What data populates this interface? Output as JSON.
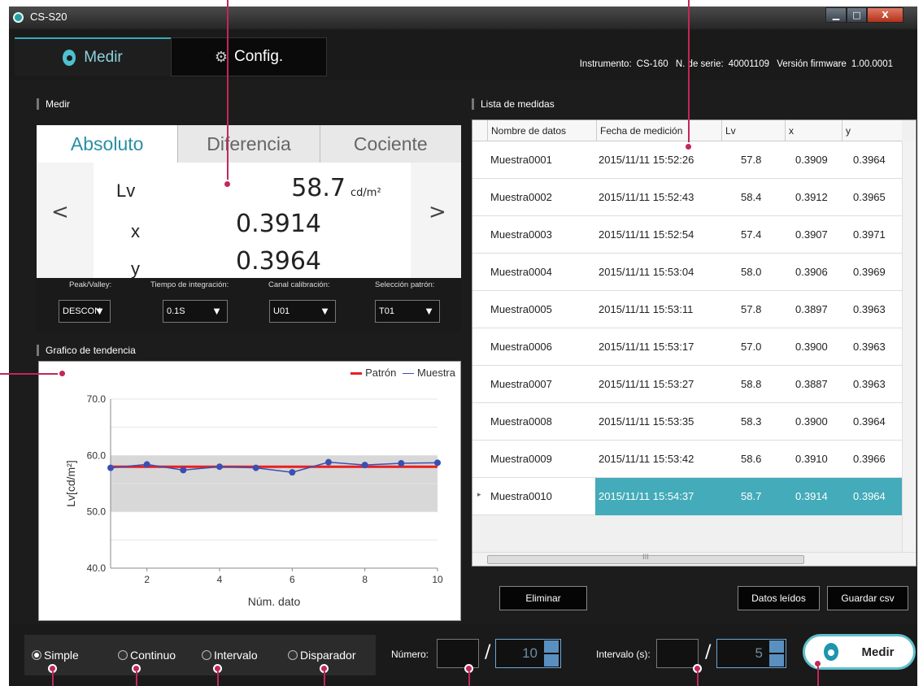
{
  "window": {
    "title": "CS-S20",
    "min": "▁",
    "max": "□",
    "close": "X"
  },
  "tabs": {
    "medir": "Medir",
    "config": "Config."
  },
  "instrument": {
    "instr_label": "Instrumento:",
    "instr_value": "CS-160",
    "serial_label": "N. de serie:",
    "serial_value": "40001109",
    "fw_label": "Versión firmware",
    "fw_value": "1.00.0001"
  },
  "sections": {
    "medir": "Medir",
    "lista": "Lista de medidas",
    "grafico": "Grafico de tendencia"
  },
  "measure": {
    "tabs": [
      "Absoluto",
      "Diferencia",
      "Cociente"
    ],
    "lv_label": "Lv",
    "lv_value": "58.7",
    "lv_unit": "cd/m²",
    "x_label": "x",
    "x_value": "0.3914",
    "y_label": "y",
    "y_value": "0.3964",
    "prev": "<",
    "next": ">"
  },
  "settings": {
    "peak_label": "Peak/Valley:",
    "peak_value": "DESCON",
    "tiempo_label": "Tiempo de integración:",
    "tiempo_value": "0.1S",
    "canal_label": "Canal calibración:",
    "canal_value": "U01",
    "patron_label": "Selección patrón:",
    "patron_value": "T01"
  },
  "chart_data": {
    "type": "line",
    "xlabel": "Núm. dato",
    "ylabel": "Lv[cd/m²]",
    "ylim": [
      40,
      70
    ],
    "xlim": [
      1,
      10
    ],
    "yticks": [
      "70.0",
      "60.0",
      "50.0",
      "40.0"
    ],
    "xticks": [
      "2",
      "4",
      "6",
      "8",
      "10"
    ],
    "band": [
      50,
      60
    ],
    "legend_patron": "Patrón",
    "legend_muestra": "Muestra",
    "series": [
      {
        "name": "Patrón",
        "values": [
          58.0,
          58.0,
          58.0,
          58.0,
          58.0,
          58.0,
          58.0,
          58.0,
          58.0,
          58.0
        ]
      },
      {
        "name": "Muestra",
        "values": [
          57.8,
          58.4,
          57.4,
          58.0,
          57.8,
          57.0,
          58.8,
          58.3,
          58.6,
          58.7
        ]
      }
    ],
    "x": [
      1,
      2,
      3,
      4,
      5,
      6,
      7,
      8,
      9,
      10
    ],
    "colors": {
      "patron": "#e82020",
      "muestra": "#3a4fb3",
      "band": "#d8d8d8"
    }
  },
  "list": {
    "headers": [
      "Nombre de datos",
      "Fecha de medición",
      "Lv",
      "x",
      "y"
    ],
    "rows": [
      [
        "Muestra0001",
        "2015/11/11 15:52:26",
        "57.8",
        "0.3909",
        "0.3964"
      ],
      [
        "Muestra0002",
        "2015/11/11 15:52:43",
        "58.4",
        "0.3912",
        "0.3965"
      ],
      [
        "Muestra0003",
        "2015/11/11 15:52:54",
        "57.4",
        "0.3907",
        "0.3971"
      ],
      [
        "Muestra0004",
        "2015/11/11 15:53:04",
        "58.0",
        "0.3906",
        "0.3969"
      ],
      [
        "Muestra0005",
        "2015/11/11 15:53:11",
        "57.8",
        "0.3897",
        "0.3963"
      ],
      [
        "Muestra0006",
        "2015/11/11 15:53:17",
        "57.0",
        "0.3900",
        "0.3963"
      ],
      [
        "Muestra0007",
        "2015/11/11 15:53:27",
        "58.8",
        "0.3887",
        "0.3963"
      ],
      [
        "Muestra0008",
        "2015/11/11 15:53:35",
        "58.3",
        "0.3900",
        "0.3964"
      ],
      [
        "Muestra0009",
        "2015/11/11 15:53:42",
        "58.6",
        "0.3910",
        "0.3966"
      ],
      [
        "Muestra0010",
        "2015/11/11 15:54:37",
        "58.7",
        "0.3914",
        "0.3964"
      ]
    ],
    "selected_index": 9,
    "scroll_thumb": "III"
  },
  "actions": {
    "eliminar": "Eliminar",
    "datos_leidos": "Datos leídos",
    "guardar_csv": "Guardar csv"
  },
  "bottom": {
    "modes": [
      "Simple",
      "Continuo",
      "Intervalo",
      "Disparador"
    ],
    "selected_mode": "Simple",
    "numero_label": "Número:",
    "numero_value": "",
    "numero_total": "10",
    "intervalo_label": "Intervalo (s):",
    "intervalo_value": "",
    "intervalo_total": "5",
    "slash": "/",
    "medir_button": "Medir"
  },
  "accent_color": "#43abb9",
  "callout_color": "#c42756"
}
